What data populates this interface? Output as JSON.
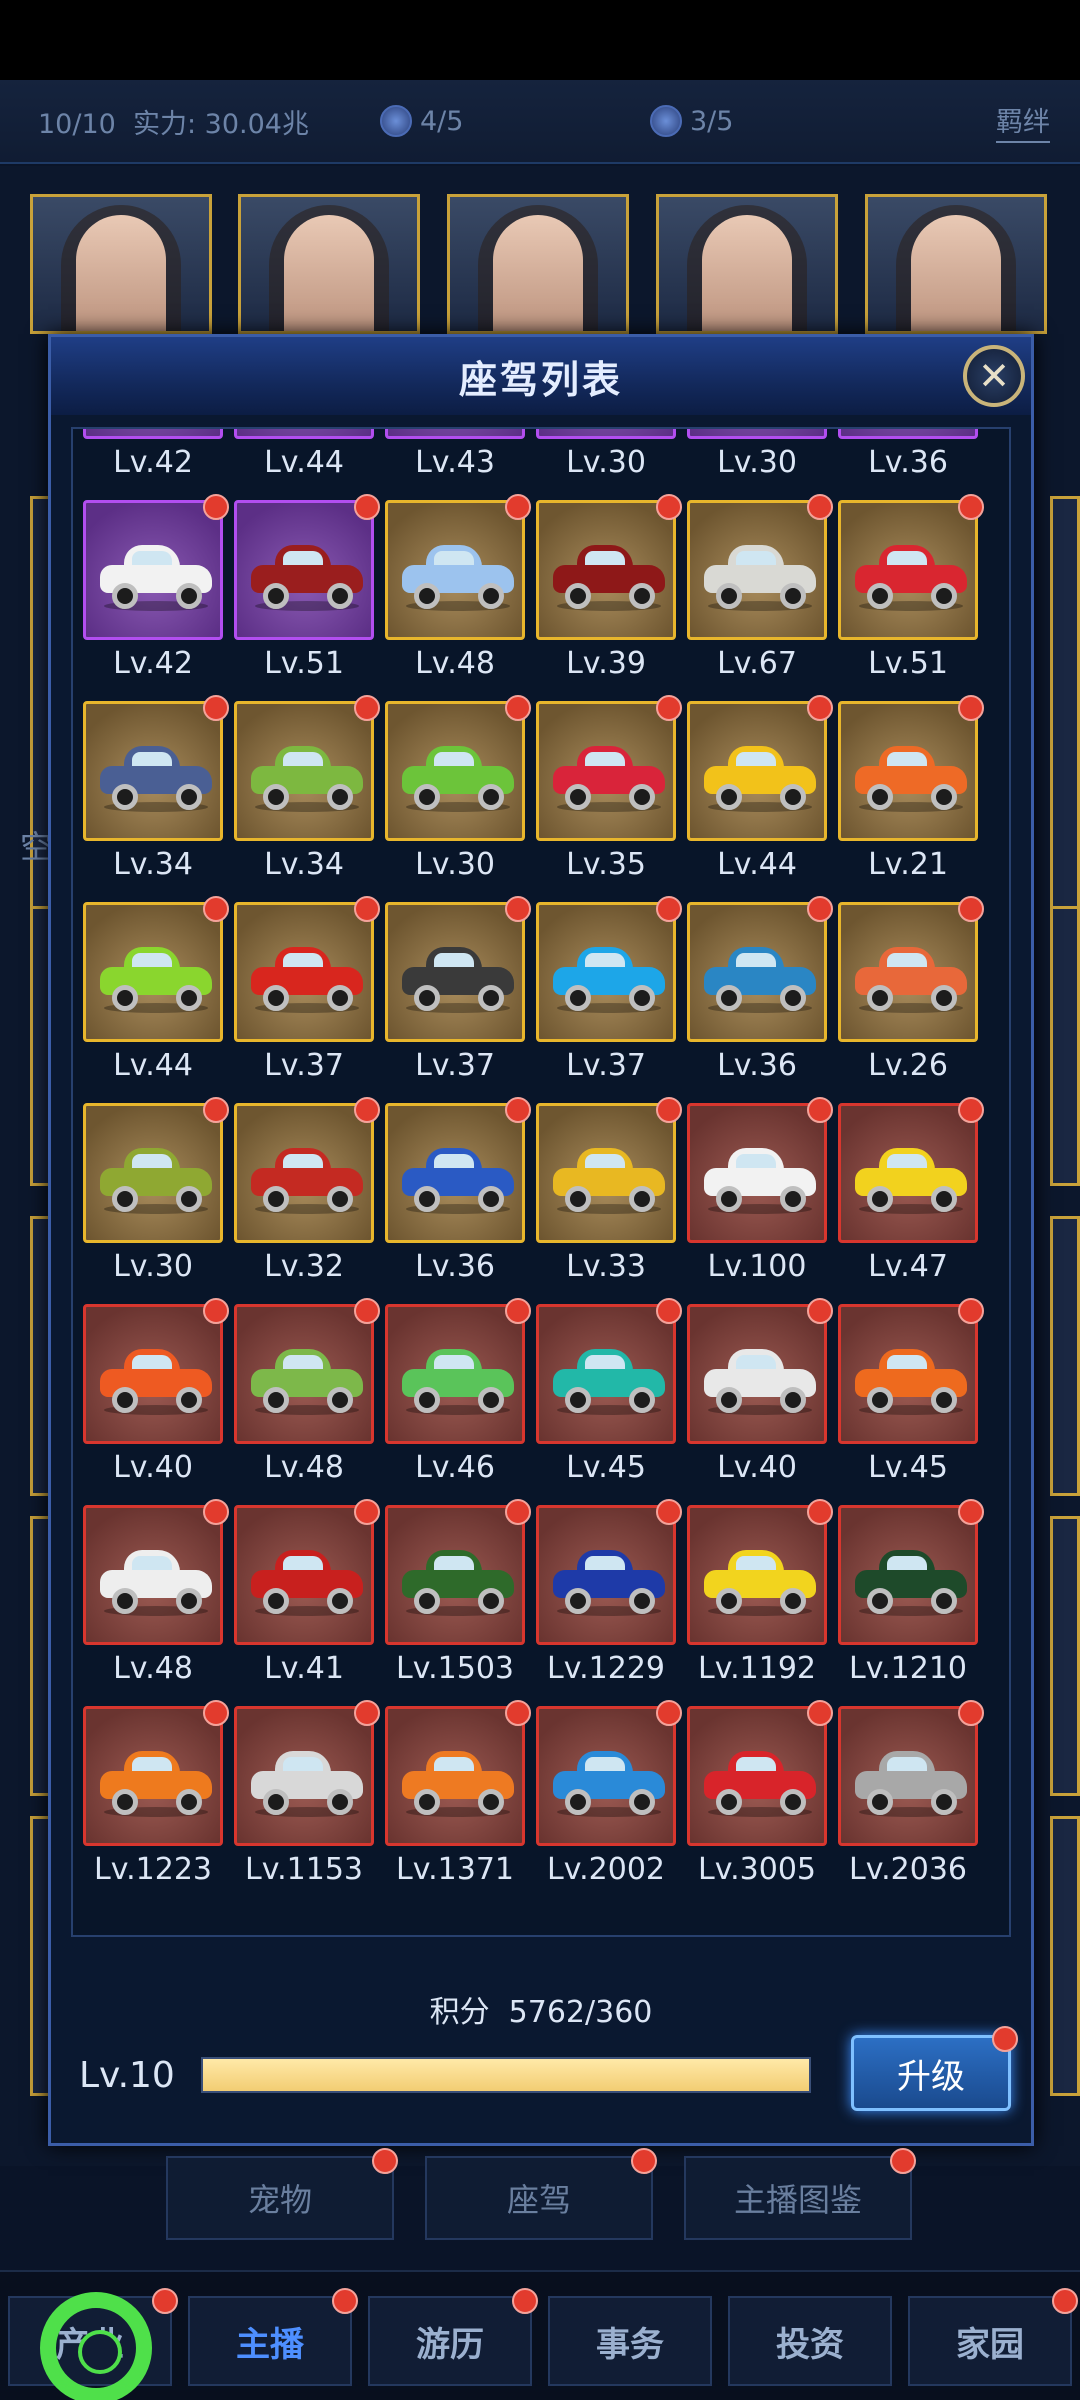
{
  "stats": {
    "count": "10/10",
    "power": "实力: 30.04兆",
    "gem1": "4/5",
    "gem2": "3/5",
    "bond": "羁绊"
  },
  "side_label": "空",
  "modal": {
    "title": "座驾列表",
    "score_label": "积分",
    "score_value": "5762/360",
    "level": "Lv.10",
    "progress": 1.0,
    "upgrade_label": "升级"
  },
  "cars": [
    {
      "lv": "Lv.42",
      "tier": "purple",
      "color": "#d8d8e8"
    },
    {
      "lv": "Lv.44",
      "tier": "purple",
      "color": "#c03a2f"
    },
    {
      "lv": "Lv.43",
      "tier": "purple",
      "color": "#f0f0f0"
    },
    {
      "lv": "Lv.30",
      "tier": "purple",
      "color": "#f0f0f0"
    },
    {
      "lv": "Lv.30",
      "tier": "purple",
      "color": "#f0f0f0"
    },
    {
      "lv": "Lv.36",
      "tier": "purple",
      "color": "#f0f0f0"
    },
    {
      "lv": "Lv.42",
      "tier": "purple",
      "color": "#f2f2f2"
    },
    {
      "lv": "Lv.51",
      "tier": "purple",
      "color": "#9a1e1e"
    },
    {
      "lv": "Lv.48",
      "tier": "gold",
      "color": "#9cc3ee"
    },
    {
      "lv": "Lv.39",
      "tier": "gold",
      "color": "#8e1818"
    },
    {
      "lv": "Lv.67",
      "tier": "gold",
      "color": "#d9d9d4"
    },
    {
      "lv": "Lv.51",
      "tier": "gold",
      "color": "#d92630"
    },
    {
      "lv": "Lv.34",
      "tier": "gold",
      "color": "#4a5f94"
    },
    {
      "lv": "Lv.34",
      "tier": "gold",
      "color": "#7db840"
    },
    {
      "lv": "Lv.30",
      "tier": "gold",
      "color": "#6cc43a"
    },
    {
      "lv": "Lv.35",
      "tier": "gold",
      "color": "#d9243a"
    },
    {
      "lv": "Lv.44",
      "tier": "gold",
      "color": "#f2c21a"
    },
    {
      "lv": "Lv.21",
      "tier": "gold",
      "color": "#ee6a26"
    },
    {
      "lv": "Lv.44",
      "tier": "gold",
      "color": "#8ad62e"
    },
    {
      "lv": "Lv.37",
      "tier": "gold",
      "color": "#d8261e"
    },
    {
      "lv": "Lv.37",
      "tier": "gold",
      "color": "#3a3a3a"
    },
    {
      "lv": "Lv.37",
      "tier": "gold",
      "color": "#1da6e8"
    },
    {
      "lv": "Lv.36",
      "tier": "gold",
      "color": "#2a86c4"
    },
    {
      "lv": "Lv.26",
      "tier": "gold",
      "color": "#e8683a"
    },
    {
      "lv": "Lv.30",
      "tier": "gold",
      "color": "#8fa832"
    },
    {
      "lv": "Lv.32",
      "tier": "gold",
      "color": "#c42a22"
    },
    {
      "lv": "Lv.36",
      "tier": "gold",
      "color": "#2a5ac4"
    },
    {
      "lv": "Lv.33",
      "tier": "gold",
      "color": "#e8b822"
    },
    {
      "lv": "Lv.100",
      "tier": "red",
      "color": "#f2f2f2"
    },
    {
      "lv": "Lv.47",
      "tier": "red",
      "color": "#f2d21e"
    },
    {
      "lv": "Lv.40",
      "tier": "red",
      "color": "#ee5a22"
    },
    {
      "lv": "Lv.48",
      "tier": "red",
      "color": "#7db84a"
    },
    {
      "lv": "Lv.46",
      "tier": "red",
      "color": "#5ac45a"
    },
    {
      "lv": "Lv.45",
      "tier": "red",
      "color": "#22b8a8"
    },
    {
      "lv": "Lv.40",
      "tier": "red",
      "color": "#e8e8e8"
    },
    {
      "lv": "Lv.45",
      "tier": "red",
      "color": "#ee6a1e"
    },
    {
      "lv": "Lv.48",
      "tier": "red",
      "color": "#eeeeee"
    },
    {
      "lv": "Lv.41",
      "tier": "red",
      "color": "#c8201e"
    },
    {
      "lv": "Lv.1503",
      "tier": "red",
      "color": "#2e6a2a"
    },
    {
      "lv": "Lv.1229",
      "tier": "red",
      "color": "#1e3aa8"
    },
    {
      "lv": "Lv.1192",
      "tier": "red",
      "color": "#f2d41e"
    },
    {
      "lv": "Lv.1210",
      "tier": "red",
      "color": "#1e4a2a"
    },
    {
      "lv": "Lv.1223",
      "tier": "red",
      "color": "#ee7a1e"
    },
    {
      "lv": "Lv.1153",
      "tier": "red",
      "color": "#d8d8d8"
    },
    {
      "lv": "Lv.1371",
      "tier": "red",
      "color": "#ee7a22"
    },
    {
      "lv": "Lv.2002",
      "tier": "red",
      "color": "#2a8ad8"
    },
    {
      "lv": "Lv.3005",
      "tier": "red",
      "color": "#d8242a"
    },
    {
      "lv": "Lv.2036",
      "tier": "red",
      "color": "#a8a8a8"
    }
  ],
  "subtabs": [
    {
      "label": "宠物"
    },
    {
      "label": "座驾"
    },
    {
      "label": "主播图鉴"
    }
  ],
  "nav": [
    {
      "label": "产业"
    },
    {
      "label": "主播"
    },
    {
      "label": "游历"
    },
    {
      "label": "事务"
    },
    {
      "label": "投资"
    },
    {
      "label": "家园"
    }
  ]
}
